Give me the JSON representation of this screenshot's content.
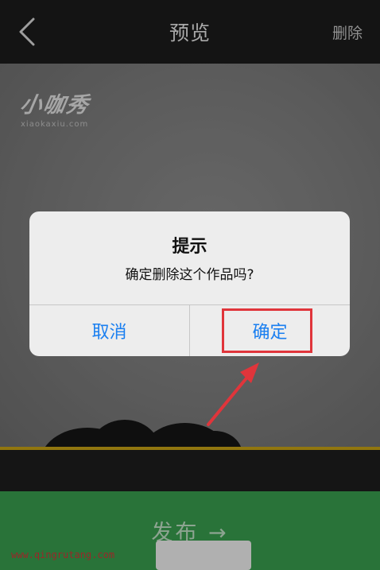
{
  "navbar": {
    "back_icon": "chevron-left-icon",
    "title": "预览",
    "action_label": "删除"
  },
  "preview": {
    "watermark_logo": "小咖秀",
    "watermark_url": "xiaokaxiu.com"
  },
  "dialog": {
    "title": "提示",
    "message": "确定删除这个作品吗?",
    "cancel_label": "取消",
    "confirm_label": "确定"
  },
  "publish": {
    "label": "发布 →",
    "site_watermark": "www.qingrutang.com"
  },
  "annotation": {
    "color": "#e0353b"
  },
  "colors": {
    "navbar_bg": "#1c1c1c",
    "publish_bg": "#39a04f",
    "dialog_button": "#1a7ff0",
    "filmstrip_accent": "#c9a416"
  }
}
